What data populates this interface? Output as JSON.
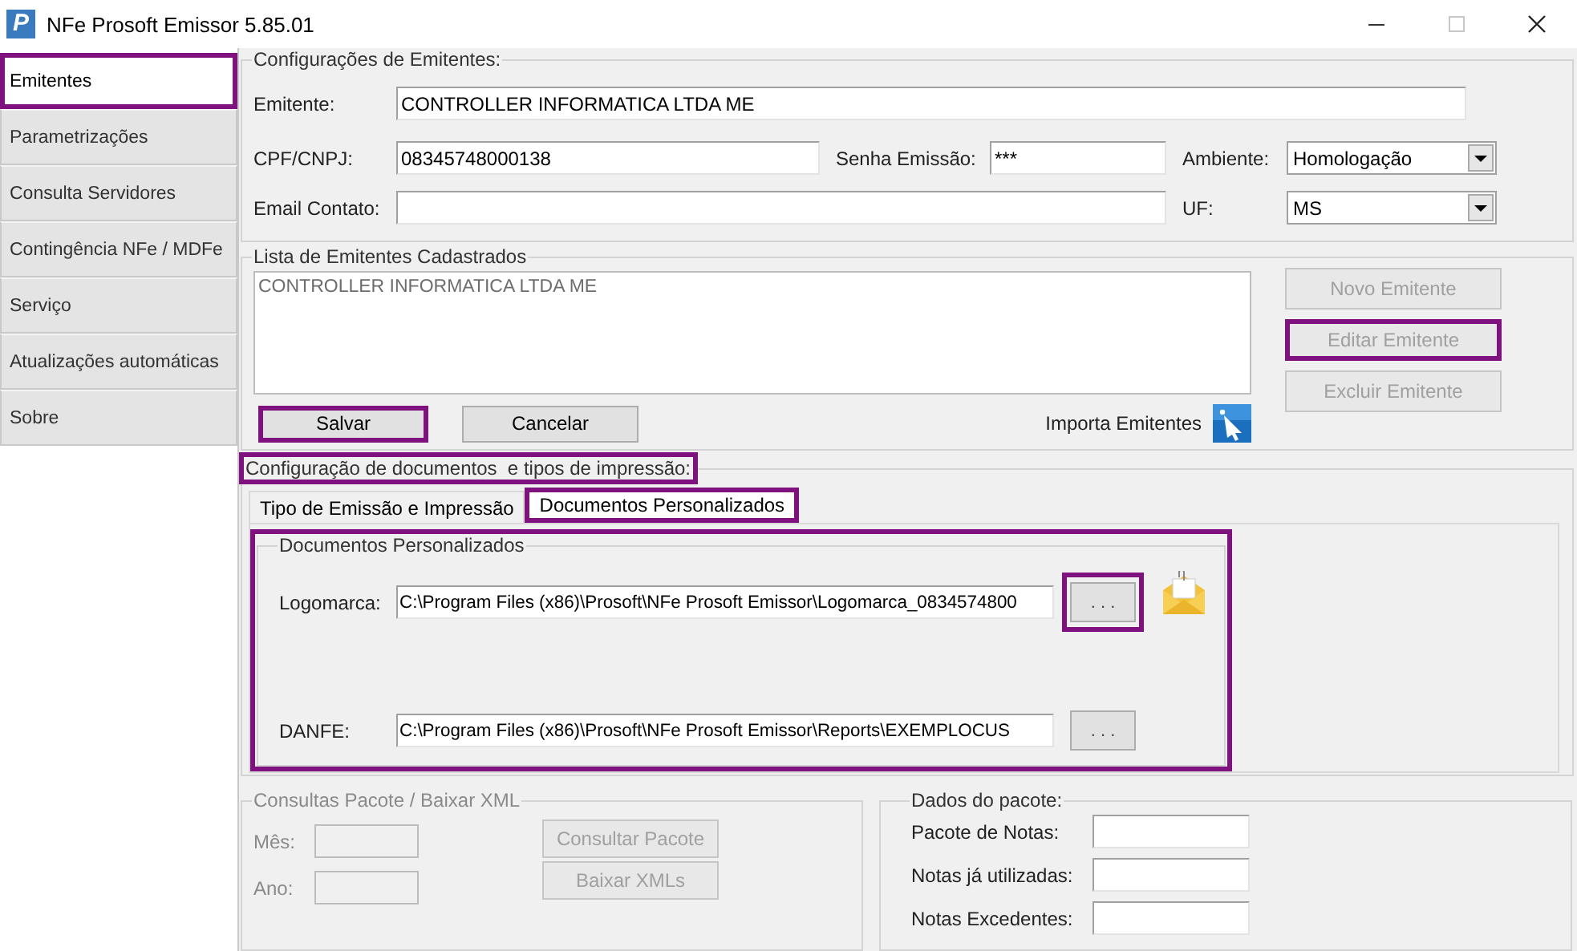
{
  "window": {
    "logo": "P",
    "title": "NFe Prosoft Emissor 5.85.01"
  },
  "sidebar": {
    "items": [
      {
        "label": "Emitentes",
        "selected": true,
        "highlighted": true
      },
      {
        "label": "Parametrizações",
        "selected": false,
        "highlighted": false
      },
      {
        "label": "Consulta Servidores",
        "selected": false,
        "highlighted": false
      },
      {
        "label": "Contingência NFe / MDFe",
        "selected": false,
        "highlighted": false
      },
      {
        "label": "Serviço",
        "selected": false,
        "highlighted": false
      },
      {
        "label": "Atualizações automáticas",
        "selected": false,
        "highlighted": false
      },
      {
        "label": "Sobre",
        "selected": false,
        "highlighted": false
      }
    ]
  },
  "emitter_settings": {
    "title": "Configurações de Emitentes:",
    "emitente": {
      "label": "Emitente:",
      "value": "CONTROLLER INFORMATICA LTDA ME"
    },
    "cpf_cnpj": {
      "label": "CPF/CNPJ:",
      "value": "08345748000138"
    },
    "senha": {
      "label": "Senha Emissão:",
      "value": "***"
    },
    "ambiente": {
      "label": "Ambiente:",
      "value": "Homologação"
    },
    "email": {
      "label": "Email Contato:"
    },
    "uf": {
      "label": "UF:",
      "value": "MS"
    }
  },
  "emitter_list": {
    "title": "Lista de Emitentes Cadastrados",
    "items": [
      "CONTROLLER INFORMATICA LTDA ME"
    ],
    "buttons": [
      {
        "label": "Novo Emitente",
        "disabled": true,
        "highlighted": false
      },
      {
        "label": "Editar Emitente",
        "disabled": true,
        "highlighted": true
      },
      {
        "label": "Excluir Emitente",
        "disabled": true,
        "highlighted": false
      }
    ],
    "actions": [
      {
        "label": "Salvar",
        "highlighted": true
      },
      {
        "label": "Cancelar",
        "highlighted": false
      }
    ],
    "import_label": "Importa Emitentes"
  },
  "documents": {
    "title": "Configuração de documentos  e tipos de impressão:",
    "title_highlighted": true,
    "tabs": [
      {
        "label": "Tipo de Emissão e Impressão",
        "selected": false,
        "highlighted": false
      },
      {
        "label": "Documentos Personalizados",
        "selected": true,
        "highlighted": true
      }
    ],
    "group": {
      "title": "Documentos Personalizados",
      "highlighted": true,
      "rows": [
        {
          "label": "Logomarca:",
          "value": "C:\\Program Files (x86)\\Prosoft\\NFe Prosoft Emissor\\Logomarca_0834574800",
          "button": ". . .",
          "button_highlighted": true,
          "preview_icon": true
        },
        {
          "label": "DANFE:",
          "value": "C:\\Program Files (x86)\\Prosoft\\NFe Prosoft Emissor\\Reports\\EXEMPLOCUS",
          "button": ". . .",
          "button_highlighted": false,
          "preview_icon": false
        }
      ]
    }
  },
  "packet_query": {
    "title": "Consultas Pacote / Baixar XML",
    "disabled": true,
    "fields": [
      {
        "label": "Mês:"
      },
      {
        "label": "Ano:"
      }
    ],
    "buttons": [
      {
        "label": "Consultar Pacote",
        "disabled": true
      },
      {
        "label": "Baixar XMLs",
        "disabled": true
      }
    ]
  },
  "packet_data": {
    "title": "Dados do pacote:",
    "fields": [
      {
        "label": "Pacote de Notas:"
      },
      {
        "label": "Notas já utilizadas:"
      },
      {
        "label": "Notas Excedentes:"
      }
    ]
  }
}
